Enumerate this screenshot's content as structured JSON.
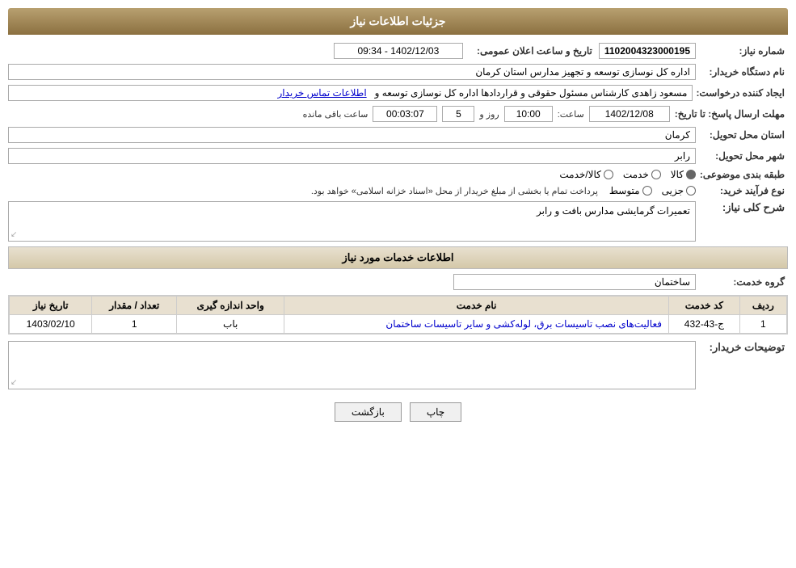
{
  "header": {
    "title": "جزئیات اطلاعات نیاز"
  },
  "fields": {
    "request_number_label": "شماره نیاز:",
    "request_number_value": "1102004323000195",
    "announcement_date_label": "تاریخ و ساعت اعلان عمومی:",
    "announcement_date_value": "1402/12/03 - 09:34",
    "buyer_org_label": "نام دستگاه خریدار:",
    "buyer_org_value": "اداره کل نوسازی  توسعه و تجهیز مدارس استان کرمان",
    "creator_label": "ایجاد کننده درخواست:",
    "creator_value": "مسعود زاهدی کارشناس مسئول حقوقی و قراردادها اداره کل نوسازی  توسعه و",
    "creator_link": "اطلاعات تماس خریدار",
    "deadline_label": "مهلت ارسال پاسخ: تا تاریخ:",
    "deadline_date": "1402/12/08",
    "deadline_time_label": "ساعت:",
    "deadline_time": "10:00",
    "deadline_days_label": "روز و",
    "deadline_days": "5",
    "deadline_remaining_label": "ساعت باقی مانده",
    "deadline_remaining": "00:03:07",
    "province_label": "استان محل تحویل:",
    "province_value": "کرمان",
    "city_label": "شهر محل تحویل:",
    "city_value": "رابر",
    "category_label": "طبقه بندی موضوعی:",
    "category_options": [
      "کالا",
      "خدمت",
      "کالا/خدمت"
    ],
    "category_selected": "کالا",
    "purchase_type_label": "نوع فرآیند خرید:",
    "purchase_type_options": [
      "جزیی",
      "متوسط"
    ],
    "purchase_type_note": "پرداخت تمام یا بخشی از مبلغ خریدار از محل «اسناد خزانه اسلامی» خواهد بود.",
    "description_section_title": "شرح کلی نیاز:",
    "description_value": "تعمیرات گرمایشی مدارس بافت و رابر",
    "services_section_title": "اطلاعات خدمات مورد نیاز",
    "service_group_label": "گروه خدمت:",
    "service_group_value": "ساختمان",
    "table_headers": [
      "ردیف",
      "کد خدمت",
      "نام خدمت",
      "واحد اندازه گیری",
      "تعداد / مقدار",
      "تاریخ نیاز"
    ],
    "table_rows": [
      {
        "row": "1",
        "code": "ج-43-432",
        "name": "فعالیت‌های نصب تاسیسات برق، لوله‌کشی و سایر تاسیسات ساختمان",
        "unit": "باب",
        "quantity": "1",
        "date": "1403/02/10"
      }
    ],
    "buyer_notes_label": "توضیحات خریدار:",
    "buyer_notes_value": ""
  },
  "buttons": {
    "print_label": "چاپ",
    "back_label": "بازگشت"
  }
}
